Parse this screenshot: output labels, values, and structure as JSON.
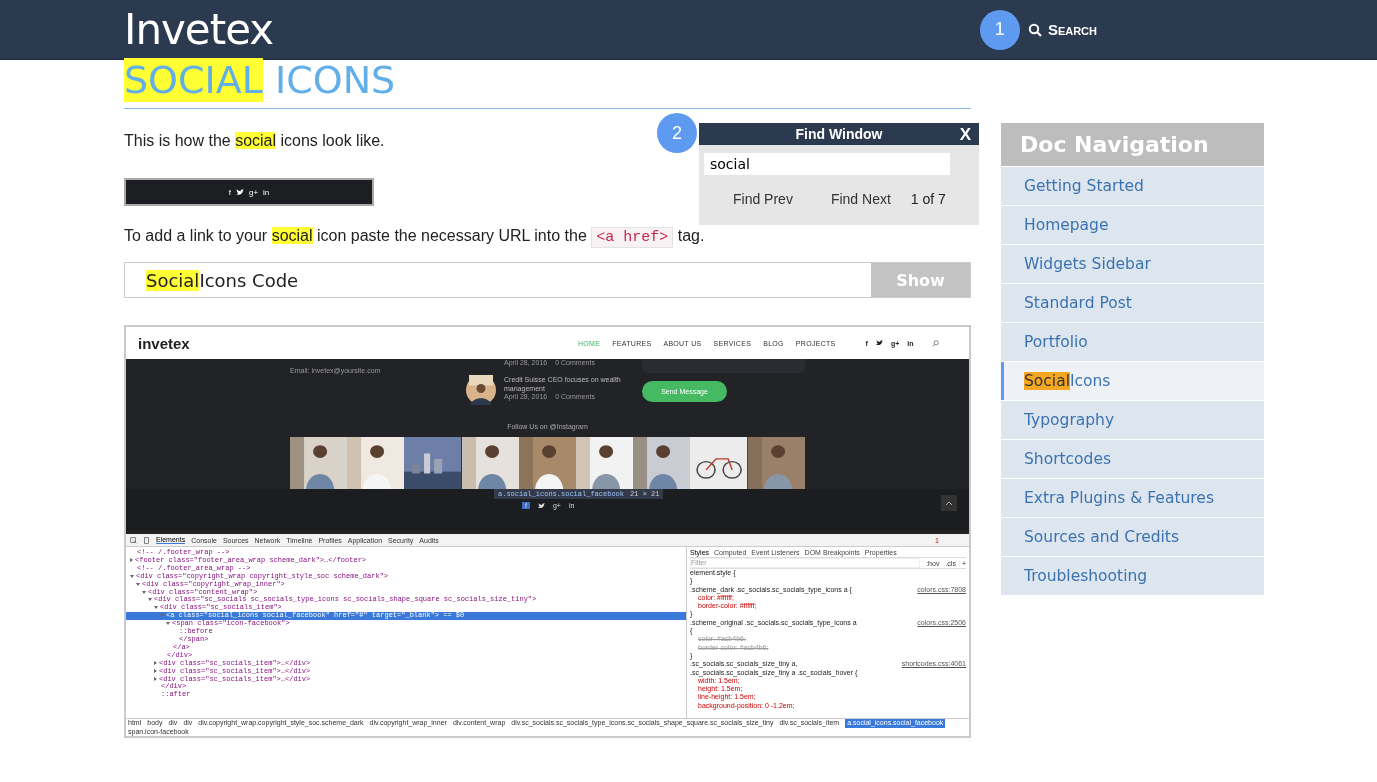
{
  "header": {
    "logo": "Invetex",
    "search": {
      "badge": "1",
      "label": "Search"
    }
  },
  "title": [
    {
      "text": "SOCIAL",
      "highlight": true
    },
    {
      "text": " ICONS",
      "highlight": false
    }
  ],
  "intro": [
    {
      "kind": "text",
      "text": "This is how the "
    },
    {
      "kind": "highlight",
      "text": "social"
    },
    {
      "kind": "text",
      "text": " icons look like."
    }
  ],
  "social_bar": [
    {
      "kind": "glyph",
      "text": "f"
    },
    {
      "kind": "bird"
    },
    {
      "kind": "glyph",
      "text": "g+"
    },
    {
      "kind": "glyph",
      "text": "in"
    }
  ],
  "link_text": [
    {
      "kind": "text",
      "text": "To add a link to your "
    },
    {
      "kind": "highlight",
      "text": "social"
    },
    {
      "kind": "text",
      "text": " icon paste the necessary URL into the "
    },
    {
      "kind": "code",
      "text": "<a href>"
    },
    {
      "kind": "text",
      "text": " tag."
    }
  ],
  "accordion": {
    "title": [
      {
        "text": "Social",
        "highlight": true
      },
      {
        "text": " Icons Code",
        "highlight": false
      }
    ],
    "button": "Show",
    "expanded": false
  },
  "find_window": {
    "badge": "2",
    "title": "Find Window",
    "close": "X",
    "value": "social",
    "prev": "Find Prev",
    "next": "Find Next",
    "count": "1 of 7"
  },
  "screenshot": {
    "logo": "invetex",
    "nav": [
      {
        "label": "HOME",
        "selected": true
      },
      {
        "label": "FEATURES",
        "selected": false
      },
      {
        "label": "ABOUT US",
        "selected": false
      },
      {
        "label": "SERVICES",
        "selected": false
      },
      {
        "label": "BLOG",
        "selected": false
      },
      {
        "label": "PROJECTS",
        "selected": false
      }
    ],
    "nav_icons": [
      {
        "kind": "glyph",
        "text": "f"
      },
      {
        "kind": "bird"
      },
      {
        "kind": "glyph",
        "text": "g+"
      },
      {
        "kind": "glyph",
        "text": "in"
      }
    ],
    "email": "Email: invetex@yoursite.com",
    "top_meta": {
      "date": "April 28, 2016",
      "comments": "0 Comments"
    },
    "post": {
      "title": "Credit Suisse CEO focuses on wealth management",
      "date": "April 28, 2016",
      "comments": "0 Comments"
    },
    "send_button": "Send Message",
    "follow": "Follow Us on @Instagram",
    "tooltip": {
      "selector": "a.social_icons.social_facebook",
      "size": "21 × 21"
    },
    "footer_icons": [
      {
        "kind": "glyph",
        "text": "f"
      },
      {
        "kind": "bird"
      },
      {
        "kind": "glyph",
        "text": "g+"
      },
      {
        "kind": "glyph",
        "text": "in"
      }
    ],
    "devtools": {
      "tabs": [
        {
          "label": "Elements",
          "selected": true
        },
        {
          "label": "Console",
          "selected": false
        },
        {
          "label": "Sources",
          "selected": false
        },
        {
          "label": "Network",
          "selected": false
        },
        {
          "label": "Timeline",
          "selected": false
        },
        {
          "label": "Profiles",
          "selected": false
        },
        {
          "label": "Application",
          "selected": false
        },
        {
          "label": "Security",
          "selected": false
        },
        {
          "label": "Audits",
          "selected": false
        }
      ],
      "errors": "1",
      "tree": [
        {
          "text": "<!-- /.footer_wrap -->",
          "selected": false
        },
        {
          "text": "<footer class=\"footer_area_wrap scheme_dark\">…</footer>",
          "selected": false,
          "expanded": false
        },
        {
          "text": "<!-- /.footer_area_wrap -->",
          "selected": false
        },
        {
          "text": "<div class=\"copyright_wrap copyright_style_soc scheme_dark\">",
          "selected": false,
          "expanded": true,
          "children": [
            {
              "text": "<div class=\"copyright_wrap_inner\">",
              "selected": false,
              "expanded": true,
              "children": [
                {
                  "text": "<div class=\"content_wrap\">",
                  "selected": false,
                  "expanded": true,
                  "children": [
                    {
                      "text": "<div class=\"sc_socials sc_socials_type_icons sc_socials_shape_square sc_socials_size_tiny\">",
                      "selected": false,
                      "expanded": true,
                      "children": [
                        {
                          "text": "<div class=\"sc_socials_item\">",
                          "selected": false,
                          "expanded": true,
                          "children": [
                            {
                              "text": "<a class=\"social_icons social_facebook\" href=\"#\" target=\"_blank\"> == $0",
                              "selected": true,
                              "expanded": true,
                              "children": [
                                {
                                  "text": "<span class=\"icon-facebook\">",
                                  "selected": false,
                                  "expanded": true,
                                  "children": [
                                    {
                                      "text": "::before",
                                      "selected": false
                                    },
                                    {
                                      "text": "</span>",
                                      "selected": false
                                    }
                                  ]
                                },
                                {
                                  "text": "</a>",
                                  "selected": false
                                }
                              ]
                            },
                            {
                              "text": "</div>",
                              "selected": false
                            }
                          ]
                        },
                        {
                          "text": "<div class=\"sc_socials_item\">…</div>",
                          "selected": false,
                          "expanded": false
                        },
                        {
                          "text": "<div class=\"sc_socials_item\">…</div>",
                          "selected": false,
                          "expanded": false
                        },
                        {
                          "text": "<div class=\"sc_socials_item\">…</div>",
                          "selected": false,
                          "expanded": false
                        },
                        {
                          "text": "</div>",
                          "selected": false
                        },
                        {
                          "text": "::after",
                          "selected": false
                        }
                      ]
                    }
                  ]
                }
              ]
            }
          ]
        }
      ],
      "style_tabs": [
        {
          "label": "Styles",
          "selected": true
        },
        {
          "label": "Computed",
          "selected": false
        },
        {
          "label": "Event Listeners",
          "selected": false
        },
        {
          "label": "DOM Breakpoints",
          "selected": false
        },
        {
          "label": "Properties",
          "selected": false
        }
      ],
      "filter": "Filter",
      "hov": ":hov",
      "cls": ".cls",
      "add": "+",
      "rules": [
        {
          "kind": "selector",
          "text": "element.style {"
        },
        {
          "kind": "brace",
          "text": "}"
        },
        {
          "kind": "selector",
          "text": ".scheme_dark .sc_socials.sc_socials_type_icons a {",
          "source": "colors.css:7808"
        },
        {
          "kind": "prop",
          "text": "color: #ffffff;",
          "struck": false
        },
        {
          "kind": "prop",
          "text": "border-color: #ffffff;",
          "struck": false
        },
        {
          "kind": "brace",
          "text": "}"
        },
        {
          "kind": "selector",
          "text": ".scheme_original .sc_socials.sc_socials_type_icons a",
          "source": "colors.css:2506"
        },
        {
          "kind": "brace",
          "text": "{"
        },
        {
          "kind": "prop",
          "text": "color: #acb4b6;",
          "struck": true
        },
        {
          "kind": "prop",
          "text": "border-color: #acb4b6;",
          "struck": true
        },
        {
          "kind": "brace",
          "text": "}"
        },
        {
          "kind": "selector",
          "text": ".sc_socials.sc_socials_size_tiny a,",
          "source": "shortcodes.css:4061"
        },
        {
          "kind": "selector",
          "text": ".sc_socials.sc_socials_size_tiny a .sc_socials_hover {"
        },
        {
          "kind": "prop",
          "text": "width: 1.5em;",
          "struck": false
        },
        {
          "kind": "prop",
          "text": "height: 1.5em;",
          "struck": false
        },
        {
          "kind": "prop",
          "text": "line-height: 1.5em;",
          "struck": false
        },
        {
          "kind": "prop",
          "text": "background-position: 0 -1.2em;",
          "struck": false
        }
      ],
      "breadcrumbs": [
        {
          "label": "html",
          "selected": false
        },
        {
          "label": "body",
          "selected": false
        },
        {
          "label": "div",
          "selected": false
        },
        {
          "label": "div",
          "selected": false
        },
        {
          "label": "div.copyright_wrap.copyright_style_soc.scheme_dark",
          "selected": false
        },
        {
          "label": "div.copyright_wrap_inner",
          "selected": false
        },
        {
          "label": "div.content_wrap",
          "selected": false
        },
        {
          "label": "div.sc_socials.sc_socials_type_icons.sc_socials_shape_square.sc_socials_size_tiny",
          "selected": false
        },
        {
          "label": "div.sc_socials_item",
          "selected": false
        },
        {
          "label": "a.social_icons.social_facebook",
          "selected": true
        },
        {
          "label": "span.icon-facebook",
          "selected": false
        }
      ]
    }
  },
  "sidebar": {
    "title": "Doc Navigation",
    "items": [
      {
        "label": [
          {
            "text": "Getting Started",
            "highlight": false
          }
        ],
        "selected": false
      },
      {
        "label": [
          {
            "text": "Homepage",
            "highlight": false
          }
        ],
        "selected": false
      },
      {
        "label": [
          {
            "text": "Widgets Sidebar",
            "highlight": false
          }
        ],
        "selected": false
      },
      {
        "label": [
          {
            "text": "Standard Post",
            "highlight": false
          }
        ],
        "selected": false
      },
      {
        "label": [
          {
            "text": "Portfolio",
            "highlight": false
          }
        ],
        "selected": false
      },
      {
        "label": [
          {
            "text": "Social",
            "highlight": true
          },
          {
            "text": " Icons",
            "highlight": false
          }
        ],
        "selected": true
      },
      {
        "label": [
          {
            "text": "Typography",
            "highlight": false
          }
        ],
        "selected": false
      },
      {
        "label": [
          {
            "text": "Shortcodes",
            "highlight": false
          }
        ],
        "selected": false
      },
      {
        "label": [
          {
            "text": "Extra Plugins & Features",
            "highlight": false
          }
        ],
        "selected": false
      },
      {
        "label": [
          {
            "text": "Sources and Credits",
            "highlight": false
          }
        ],
        "selected": false
      },
      {
        "label": [
          {
            "text": "Troubleshooting",
            "highlight": false
          }
        ],
        "selected": false
      }
    ]
  }
}
